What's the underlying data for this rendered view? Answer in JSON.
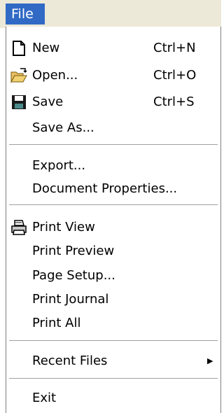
{
  "menubar": {
    "title": "File"
  },
  "menu": {
    "new_label": "New",
    "new_shortcut": "Ctrl+N",
    "open_label": "Open...",
    "open_shortcut": "Ctrl+O",
    "save_label": "Save",
    "save_shortcut": "Ctrl+S",
    "save_as_label": "Save As...",
    "export_label": "Export...",
    "document_properties_label": "Document Properties...",
    "print_view_label": "Print View",
    "print_preview_label": "Print Preview",
    "page_setup_label": "Page Setup...",
    "print_journal_label": "Print Journal",
    "print_all_label": "Print All",
    "recent_files_label": "Recent Files",
    "exit_label": "Exit"
  },
  "icons": {
    "new": "new-document-icon",
    "open": "open-folder-icon",
    "save": "floppy-disk-icon",
    "print_view": "printer-icon",
    "submenu": "submenu-arrow-icon"
  },
  "colors": {
    "menubar_background": "#ece9d8",
    "title_highlight": "#316ac5",
    "title_text": "#ffffff",
    "menu_background": "#ffffff",
    "separator": "#a0a0a0"
  }
}
